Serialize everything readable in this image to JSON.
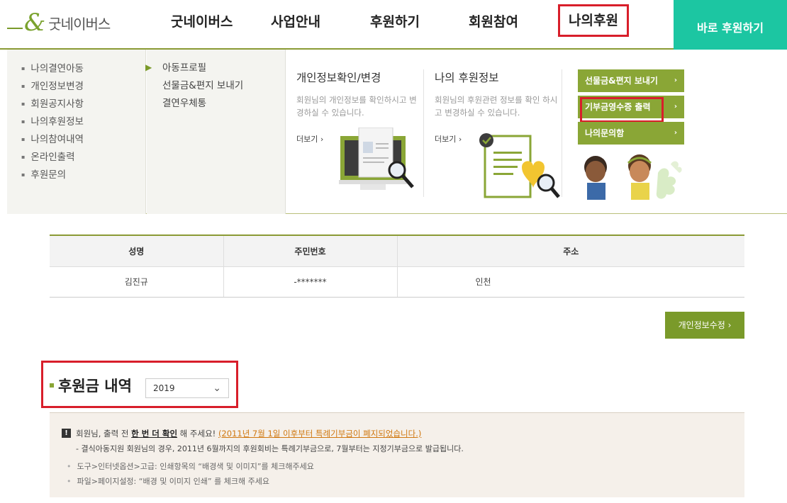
{
  "header": {
    "logo_text": "굿네이버스",
    "nav": [
      "굿네이버스",
      "사업안내",
      "후원하기",
      "회원참여",
      "나의후원"
    ],
    "cta": "바로 후원하기"
  },
  "mega_menu": {
    "my_menu": [
      "나의결연아동",
      "개인정보변경",
      "회원공지사항",
      "나의후원정보",
      "나의참여내역",
      "온라인출력",
      "후원문의"
    ],
    "sub_menu": [
      "아동프로필",
      "선물금&편지 보내기",
      "결연우체통"
    ],
    "cards": [
      {
        "title": "개인정보확인/변경",
        "desc": "회원님의 개인정보를 확인하시고 변경하실 수 있습니다.",
        "more": "더보기"
      },
      {
        "title": "나의 후원정보",
        "desc": "회원님의 후원관련 정보를 확인 하시고 변경하실 수 있습니다.",
        "more": "더보기"
      }
    ],
    "quick_buttons": [
      "선물금&편지 보내기",
      "기부금영수증 출력",
      "나의문의함"
    ]
  },
  "member_table": {
    "headers": [
      "성명",
      "주민번호",
      "주소"
    ],
    "row": [
      "김진규",
      "-*******",
      "인천"
    ]
  },
  "edit_button": "개인정보수정",
  "donation": {
    "title": "후원금 내역",
    "year": "2019"
  },
  "notice": {
    "l1_a": "회원님, 출력 전 ",
    "l1_b": "한 번 더 확인",
    "l1_c": " 해 주세요! ",
    "l1_d": "(2011년 7월 1일 이후부터 특례기부금이 폐지되었습니다.)",
    "l2": "- 결식아동지원 회원님의 경우, 2011년 6월까지의 후원회비는 특례기부금으로, 7월부터는 지정기부금으로 발급됩니다.",
    "b1": "도구>인터넷옵션>고급: 인쇄항목의 “배경색 및 이미지”를 체크해주세요",
    "b2": "파일>페이지설정: “배경 및 이미지 인쇄” 를 체크해 주세요"
  }
}
